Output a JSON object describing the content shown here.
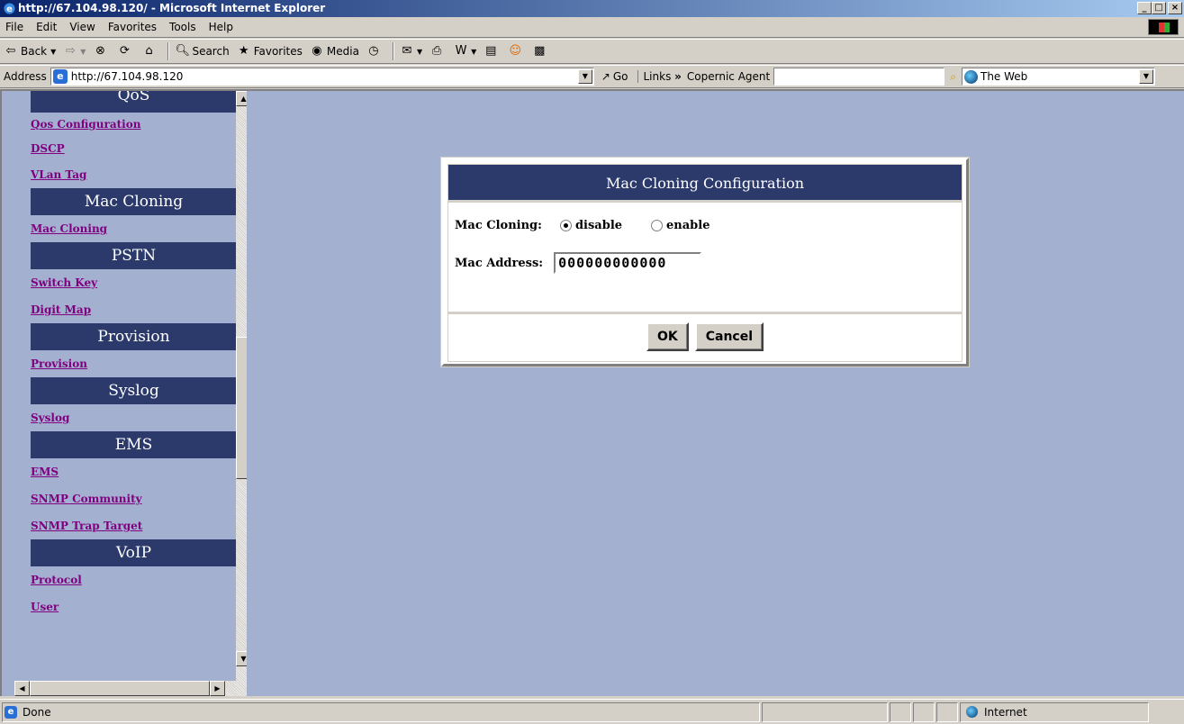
{
  "window": {
    "title": "http://67.104.98.120/ - Microsoft Internet Explorer",
    "minimize": "_",
    "maximize": "□",
    "close": "×"
  },
  "menu": [
    "File",
    "Edit",
    "View",
    "Favorites",
    "Tools",
    "Help"
  ],
  "toolbar": {
    "back": "Back",
    "search": "Search",
    "favorites": "Favorites",
    "media": "Media"
  },
  "address": {
    "label": "Address",
    "url": "http://67.104.98.120",
    "go": "Go",
    "links": "Links",
    "copernic": "Copernic Agent",
    "search_scope": "The Web"
  },
  "nav": {
    "sections": [
      {
        "title": "QoS",
        "links": [
          "Qos Configuration",
          "DSCP",
          "VLan Tag"
        ]
      },
      {
        "title": "Mac Cloning",
        "links": [
          "Mac Cloning"
        ]
      },
      {
        "title": "PSTN",
        "links": [
          "Switch Key",
          "Digit Map"
        ]
      },
      {
        "title": "Provision",
        "links": [
          "Provision"
        ]
      },
      {
        "title": "Syslog",
        "links": [
          "Syslog"
        ]
      },
      {
        "title": "EMS",
        "links": [
          "EMS",
          "SNMP Community",
          "SNMP Trap Target"
        ]
      },
      {
        "title": "VoIP",
        "links": [
          "Protocol",
          "User"
        ]
      }
    ]
  },
  "dialog": {
    "title": "Mac Cloning Configuration",
    "cloning_label": "Mac Cloning:",
    "option_disable": "disable",
    "option_enable": "enable",
    "selected": "disable",
    "address_label": "Mac Address:",
    "address_value": "000000000000",
    "ok": "OK",
    "cancel": "Cancel"
  },
  "status": {
    "text": "Done",
    "zone": "Internet"
  }
}
